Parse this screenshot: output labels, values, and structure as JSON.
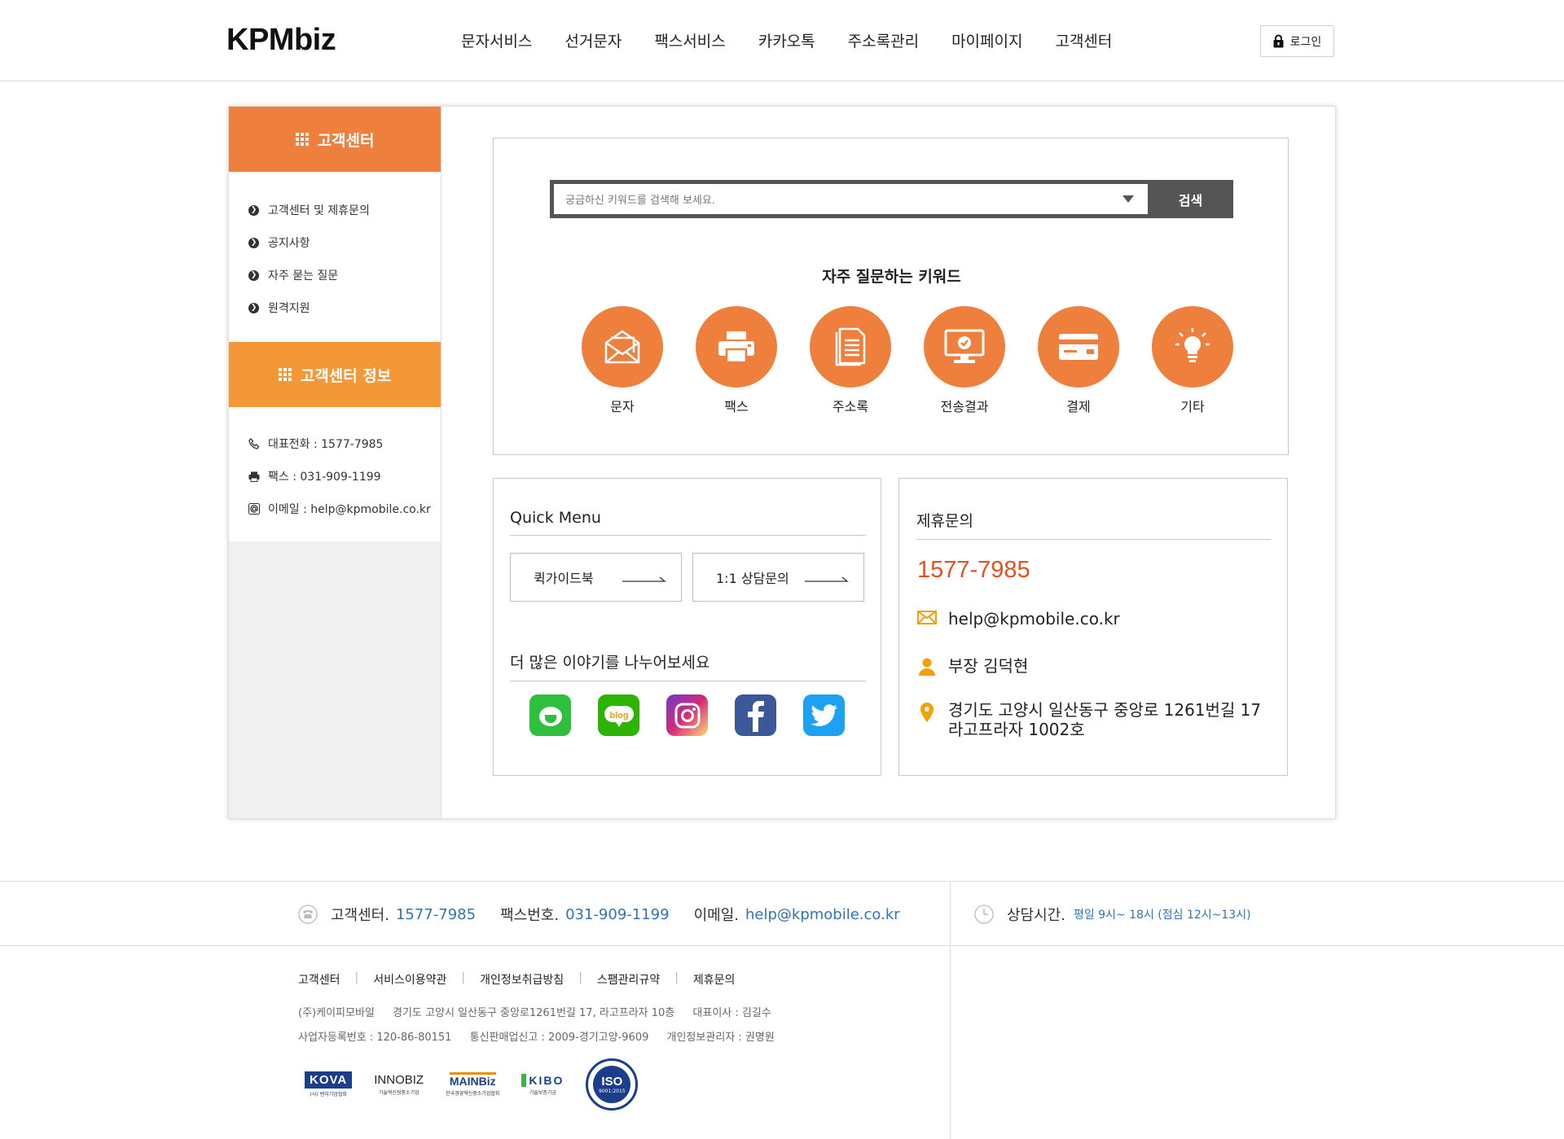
{
  "header": {
    "logo": "KPMbiz",
    "nav": [
      "문자서비스",
      "선거문자",
      "팩스서비스",
      "카카오톡",
      "주소록관리",
      "마이페이지",
      "고객센터"
    ],
    "login_label": "로그인"
  },
  "sidebar": {
    "title": "고객센터",
    "items": [
      {
        "label": "고객센터 및 제휴문의"
      },
      {
        "label": "공지사항"
      },
      {
        "label": "자주 묻는 질문"
      },
      {
        "label": "원격지원"
      }
    ],
    "info_title": "고객센터 정보",
    "info": [
      {
        "icon": "phone-icon",
        "label": "대표전화 : 1577-7985"
      },
      {
        "icon": "fax-icon",
        "label": "팩스 : 031-909-1199"
      },
      {
        "icon": "at-icon",
        "label": "이메일 : help@kpmobile.co.kr"
      }
    ]
  },
  "search": {
    "placeholder": "궁금하신 키워드를 검색해 보세요.",
    "button_label": "검색"
  },
  "keywords": {
    "title": "자주 질문하는 키워드",
    "items": [
      {
        "icon": "envelope-icon",
        "label": "문자"
      },
      {
        "icon": "printer-icon",
        "label": "팩스"
      },
      {
        "icon": "document-icon",
        "label": "주소록"
      },
      {
        "icon": "monitor-check-icon",
        "label": "전송결과"
      },
      {
        "icon": "credit-card-icon",
        "label": "결제"
      },
      {
        "icon": "lightbulb-icon",
        "label": "기타"
      }
    ]
  },
  "quick_menu": {
    "title": "Quick Menu",
    "buttons": [
      {
        "label": "퀵가이드북"
      },
      {
        "label": "1:1 상담문의"
      }
    ],
    "share_title": "더 많은 이야기를 나누어보세요",
    "sns": [
      "kakao-story-icon",
      "naver-blog-icon",
      "instagram-icon",
      "facebook-icon",
      "twitter-icon"
    ]
  },
  "partnership": {
    "title": "제휴문의",
    "phone": "1577-7985",
    "email": "help@kpmobile.co.kr",
    "manager": "부장 김덕현",
    "address_line1": "경기도 고양시 일산동구 중앙로 1261번길 17",
    "address_line2": "라고프라자 1002호"
  },
  "footer": {
    "contact": [
      {
        "label": "고객센터.",
        "value": "1577-7985"
      },
      {
        "label": "팩스번호.",
        "value": "031-909-1199"
      },
      {
        "label": "이메일.",
        "value": "help@kpmobile.co.kr"
      }
    ],
    "hours_label": "상담시간.",
    "hours_value": "평일 9시~ 18시 (점심 12시~13시)",
    "links": [
      "고객센터",
      "서비스이용약관",
      "개인정보취급방침",
      "스팸관리규약",
      "제휴문의"
    ],
    "info_line1": [
      "(주)케이피모바일",
      "경기도 고양시 일산동구 중앙로1261번길 17, 라고프라자 10층",
      "대표이사 : 김길수"
    ],
    "info_line2": [
      "사업자등록번호 : 120-86-80151",
      "통신판매업신고 : 2009-경기고양-9609",
      "개인정보관리자 : 권명원"
    ],
    "certs": {
      "kova": "KOVA",
      "kova_sub": "(사) 벤처기업협회",
      "innobiz": "INNOBIZ",
      "innobiz_sub": "기술혁신형중소기업",
      "mainbiz": "MAINBiz",
      "mainbiz_sub": "한국경영혁신중소기업협회",
      "kibo": "KIBO",
      "kibo_sub": "기술보증기금",
      "iso": "ISO",
      "iso_sub": "9001:2015"
    }
  },
  "colors": {
    "accent_orange": "#ee7f3d",
    "accent_orange_light": "#f39737",
    "phone_red": "#e5501f",
    "footer_blue": "#2f74b8",
    "search_dark": "#555555"
  }
}
